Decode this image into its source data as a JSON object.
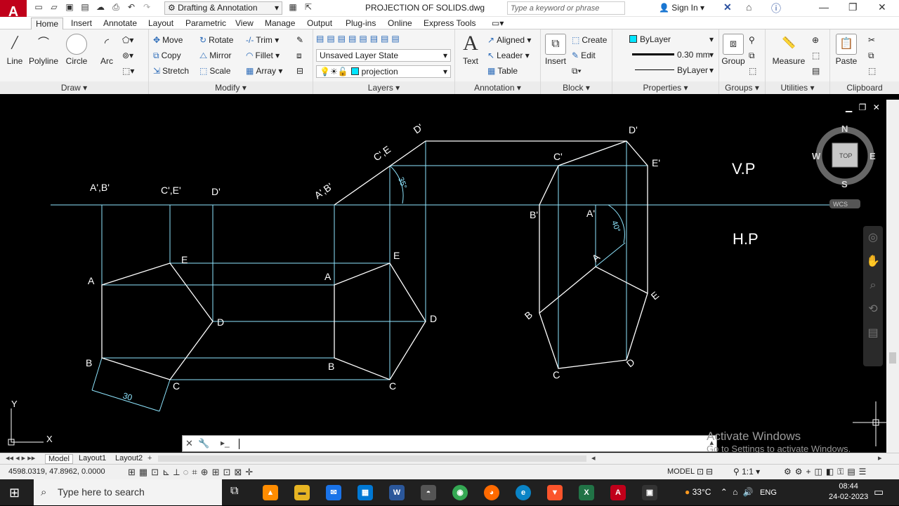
{
  "app": {
    "logo": "A",
    "workspace": "Drafting & Annotation",
    "document_title": "PROJECTION OF SOLIDS.dwg",
    "search_placeholder": "Type a keyword or phrase",
    "sign_in": "Sign In"
  },
  "tabs": [
    "Home",
    "Insert",
    "Annotate",
    "Layout",
    "Parametric",
    "View",
    "Manage",
    "Output",
    "Plug-ins",
    "Online",
    "Express Tools"
  ],
  "ribbon": {
    "draw": {
      "title": "Draw",
      "line": "Line",
      "polyline": "Polyline",
      "circle": "Circle",
      "arc": "Arc"
    },
    "modify": {
      "title": "Modify",
      "move": "Move",
      "rotate": "Rotate",
      "trim": "Trim",
      "copy": "Copy",
      "mirror": "Mirror",
      "fillet": "Fillet",
      "stretch": "Stretch",
      "scale": "Scale",
      "array": "Array"
    },
    "layers": {
      "title": "Layers",
      "layer_state": "Unsaved Layer State",
      "current_layer": "projection"
    },
    "annotation": {
      "title": "Annotation",
      "text": "Text",
      "aligned": "Aligned",
      "leader": "Leader",
      "table": "Table"
    },
    "block": {
      "title": "Block",
      "insert": "Insert",
      "create": "Create",
      "edit": "Edit"
    },
    "properties": {
      "title": "Properties",
      "color": "ByLayer",
      "lineweight": "0.30 mm",
      "linetype": "ByLayer"
    },
    "groups": {
      "title": "Groups",
      "group": "Group"
    },
    "utilities": {
      "title": "Utilities",
      "measure": "Measure"
    },
    "clipboard": {
      "title": "Clipboard",
      "paste": "Paste"
    }
  },
  "viewcube": {
    "n": "N",
    "s": "S",
    "e": "E",
    "w": "W",
    "face": "TOP",
    "wcs": "WCS"
  },
  "drawing": {
    "vp": "V.P",
    "hp": "H.P",
    "front_labels_1": {
      "ab": "A',B'",
      "ce": "C',E'",
      "d": "D'"
    },
    "top_labels_1": {
      "a": "A",
      "b": "B",
      "c": "C",
      "d": "D",
      "e": "E",
      "dim": "30"
    },
    "front_labels_2": {
      "ab": "A',B'",
      "ce": "C',E",
      "d": "D'",
      "angle": "35°"
    },
    "top_labels_2": {
      "a": "A",
      "b": "B",
      "c": "C",
      "d": "D",
      "e": "E"
    },
    "front_labels_3": {
      "c": "C'",
      "d": "D'",
      "e": "E'",
      "b": "B'",
      "a": "A'",
      "angle": "40°"
    },
    "top_labels_3": {
      "a": "A",
      "b": "B",
      "c": "C",
      "d": "D",
      "e": "E"
    }
  },
  "ucs": {
    "x": "X",
    "y": "Y"
  },
  "watermark": {
    "line1": "Activate Windows",
    "line2": "Go to Settings to activate Windows."
  },
  "layout_tabs": [
    "Model",
    "Layout1",
    "Layout2"
  ],
  "status": {
    "coords": "4598.0319, 47.8962, 0.0000",
    "model": "MODEL",
    "scale": "1:1"
  },
  "taskbar": {
    "search": "Type here to search",
    "temp": "33°C",
    "lang": "ENG",
    "time": "08:44",
    "date": "24-02-2023"
  }
}
